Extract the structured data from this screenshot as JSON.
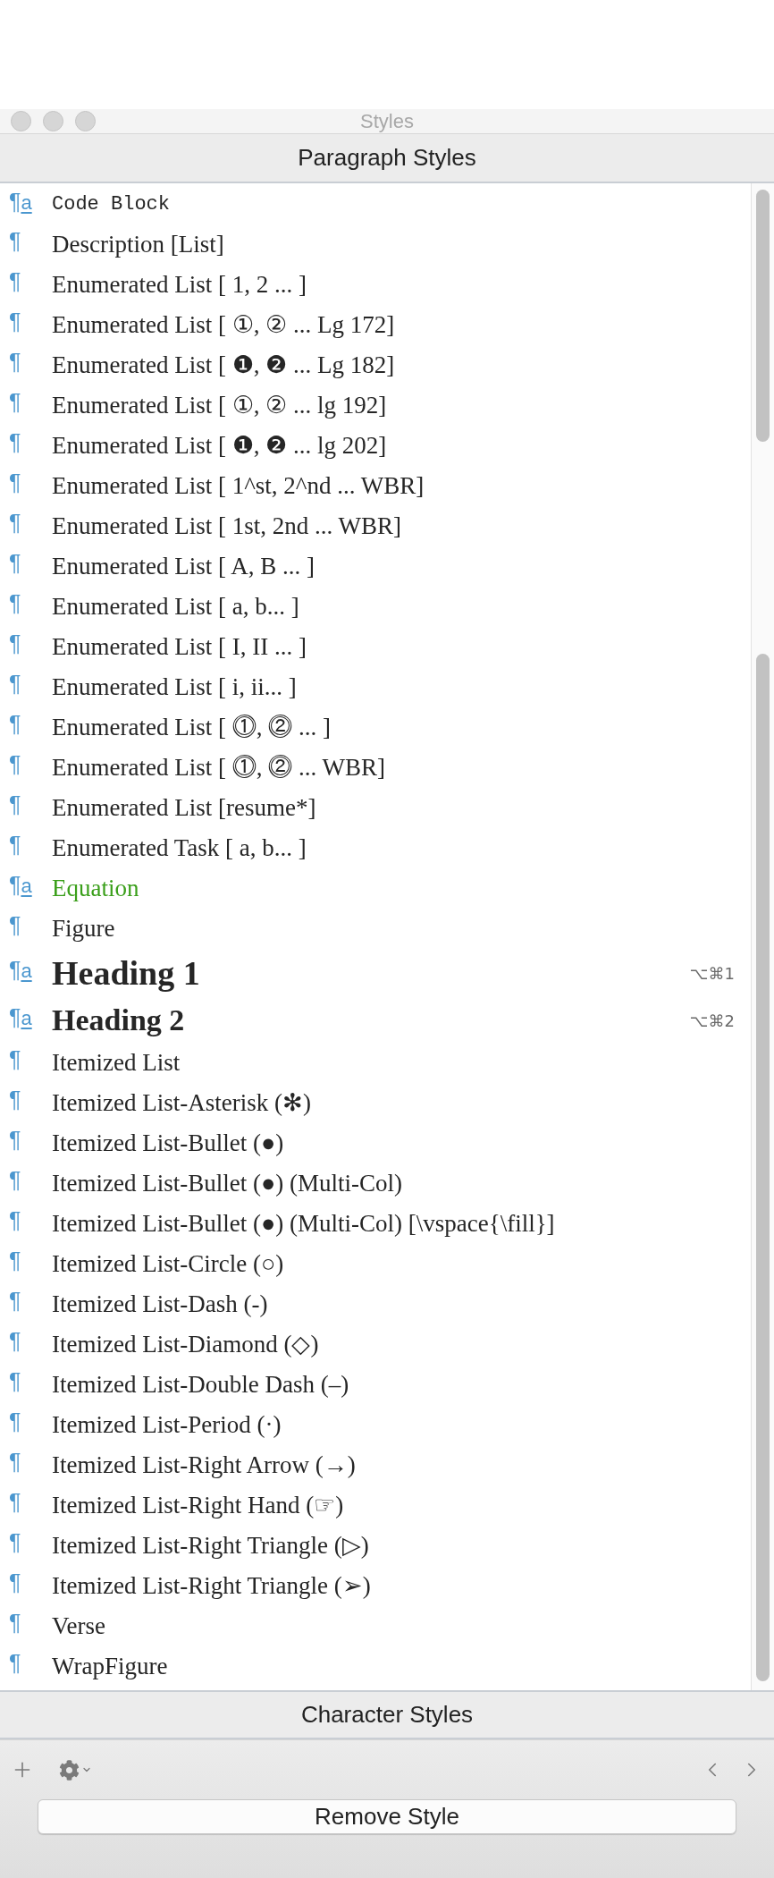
{
  "window": {
    "title": "Styles"
  },
  "paragraph_styles": {
    "header": "Paragraph Styles",
    "items": [
      {
        "marker": "¶",
        "marker_letter": "a",
        "name": "Code Block",
        "kind": "mono"
      },
      {
        "marker": "¶",
        "name": "Description [List]",
        "kind": "serif"
      },
      {
        "marker": "¶",
        "name": "Enumerated List [ 1, 2 ... ]",
        "kind": "serif"
      },
      {
        "marker": "¶",
        "name": "Enumerated List [ ①, ② ... Lg 172]",
        "kind": "serif"
      },
      {
        "marker": "¶",
        "name": "Enumerated List [ ❶, ❷ ... Lg 182]",
        "kind": "serif"
      },
      {
        "marker": "¶",
        "name": "Enumerated List [ ①, ② ... lg 192]",
        "kind": "serif"
      },
      {
        "marker": "¶",
        "name": "Enumerated List [ ❶, ❷ ... lg 202]",
        "kind": "serif"
      },
      {
        "marker": "¶",
        "name": "Enumerated List [ 1^st, 2^nd ... WBR]",
        "kind": "serif"
      },
      {
        "marker": "¶",
        "name": "Enumerated List [ 1st, 2nd ... WBR]",
        "kind": "serif"
      },
      {
        "marker": "¶",
        "name": "Enumerated List [ A, B ... ]",
        "kind": "serif"
      },
      {
        "marker": "¶",
        "name": "Enumerated List [ a, b... ]",
        "kind": "serif"
      },
      {
        "marker": "¶",
        "name": "Enumerated List [ I, II ... ]",
        "kind": "serif"
      },
      {
        "marker": "¶",
        "name": "Enumerated List [ i, ii... ]",
        "kind": "serif"
      },
      {
        "marker": "¶",
        "name": "Enumerated List [ ⓵, ⓶ ... ]",
        "kind": "serif"
      },
      {
        "marker": "¶",
        "name": "Enumerated List [ ⓵, ⓶ ... WBR]",
        "kind": "serif"
      },
      {
        "marker": "¶",
        "name": "Enumerated List [resume*]",
        "kind": "serif"
      },
      {
        "marker": "¶",
        "name": "Enumerated Task [ a, b... ]",
        "kind": "serif"
      },
      {
        "marker": "¶",
        "marker_letter": "a",
        "name": "Equation",
        "kind": "serif",
        "color": "#3a9f1a"
      },
      {
        "marker": "¶",
        "name": "Figure",
        "kind": "serif"
      },
      {
        "marker": "¶",
        "marker_letter": "a",
        "name": "Heading 1",
        "kind": "heading1",
        "shortcut": "⌥⌘1"
      },
      {
        "marker": "¶",
        "marker_letter": "a",
        "name": "Heading 2",
        "kind": "heading2",
        "shortcut": "⌥⌘2"
      },
      {
        "marker": "¶",
        "name": "Itemized List",
        "kind": "serif"
      },
      {
        "marker": "¶",
        "name": "Itemized List-Asterisk (✻)",
        "kind": "serif"
      },
      {
        "marker": "¶",
        "name": "Itemized List-Bullet (●)",
        "kind": "serif"
      },
      {
        "marker": "¶",
        "name": "Itemized List-Bullet (●) (Multi-Col)",
        "kind": "serif"
      },
      {
        "marker": "¶",
        "name": "Itemized List-Bullet (●) (Multi-Col) [\\vspace{\\fill}]",
        "kind": "serif"
      },
      {
        "marker": "¶",
        "name": "Itemized List-Circle (○)",
        "kind": "serif"
      },
      {
        "marker": "¶",
        "name": "Itemized List-Dash (-)",
        "kind": "serif"
      },
      {
        "marker": "¶",
        "name": "Itemized List-Diamond (◇)",
        "kind": "serif"
      },
      {
        "marker": "¶",
        "name": "Itemized List-Double Dash (–)",
        "kind": "serif"
      },
      {
        "marker": "¶",
        "name": "Itemized List-Period (·)",
        "kind": "serif"
      },
      {
        "marker": "¶",
        "name": "Itemized List-Right Arrow (→)",
        "kind": "serif"
      },
      {
        "marker": "¶",
        "name": "Itemized List-Right Hand (☞)",
        "kind": "serif"
      },
      {
        "marker": "¶",
        "name": "Itemized List-Right Triangle (▷)",
        "kind": "serif"
      },
      {
        "marker": "¶",
        "name": "Itemized List-Right Triangle (➢)",
        "kind": "serif"
      },
      {
        "marker": "¶",
        "name": "Verse",
        "kind": "serif"
      },
      {
        "marker": "¶",
        "name": "WrapFigure",
        "kind": "serif"
      }
    ]
  },
  "character_styles": {
    "header": "Character Styles"
  },
  "remove_button": {
    "label": "Remove Style"
  }
}
